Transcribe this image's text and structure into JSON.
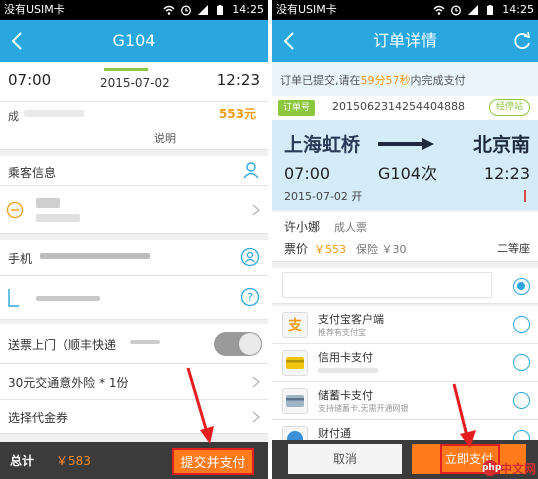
{
  "status_bar": {
    "carrier": "没有USIM卡",
    "time": "14:25"
  },
  "left": {
    "nav_title": "G104",
    "trip": {
      "depart_time": "07:00",
      "date": "2015-07-02",
      "arrive_time": "12:23"
    },
    "seat": {
      "label_prefix": "成",
      "price": "553元",
      "note": "说明"
    },
    "passenger": {
      "section_label": "乘客信息"
    },
    "phone": {
      "label": "手机"
    },
    "delivery": {
      "label": "送票上门（顺丰快递"
    },
    "insurance": {
      "label": "30元交通意外险 * 1份"
    },
    "voucher": {
      "label": "选择代金券"
    },
    "bottom": {
      "total_label": "总计",
      "total_amount": "￥583",
      "submit_label": "提交并支付"
    }
  },
  "right": {
    "nav_title": "订单详情",
    "notice": {
      "prefix": "订单已提交,请在",
      "countdown": "59分57秒",
      "suffix": "内完成支付"
    },
    "order": {
      "badge": "订单号",
      "number": "2015062314254404888",
      "stops_label": "经停站"
    },
    "ticket": {
      "from_station": "上海虹桥",
      "to_station": "北京南",
      "train": "G104次",
      "depart_time": "07:00",
      "arrive_time": "12:23",
      "date_line": "2015-07-02 开"
    },
    "passenger": {
      "name": "许小娜",
      "ticket_type": "成人票",
      "price_label": "票价",
      "price": "￥553",
      "insurance": "保险 ￥30",
      "seat_class": "二等座"
    },
    "payments": [
      {
        "name": "支付宝客户端",
        "desc": "推荐有支付宝"
      },
      {
        "name": "信用卡支付",
        "desc": ""
      },
      {
        "name": "储蓄卡支付",
        "desc": "支持储蓄卡,无需开通网银"
      },
      {
        "name": "财付通",
        "desc": ""
      }
    ],
    "bottom": {
      "cancel_label": "取消",
      "pay_label": "立即支付"
    }
  },
  "watermark": "中文网",
  "colors": {
    "nav_blue": "#2ba7df",
    "accent_orange": "#ff7a1a",
    "price_orange": "#f39c12",
    "highlight_red": "#e51f1f",
    "green": "#8dc63f"
  }
}
